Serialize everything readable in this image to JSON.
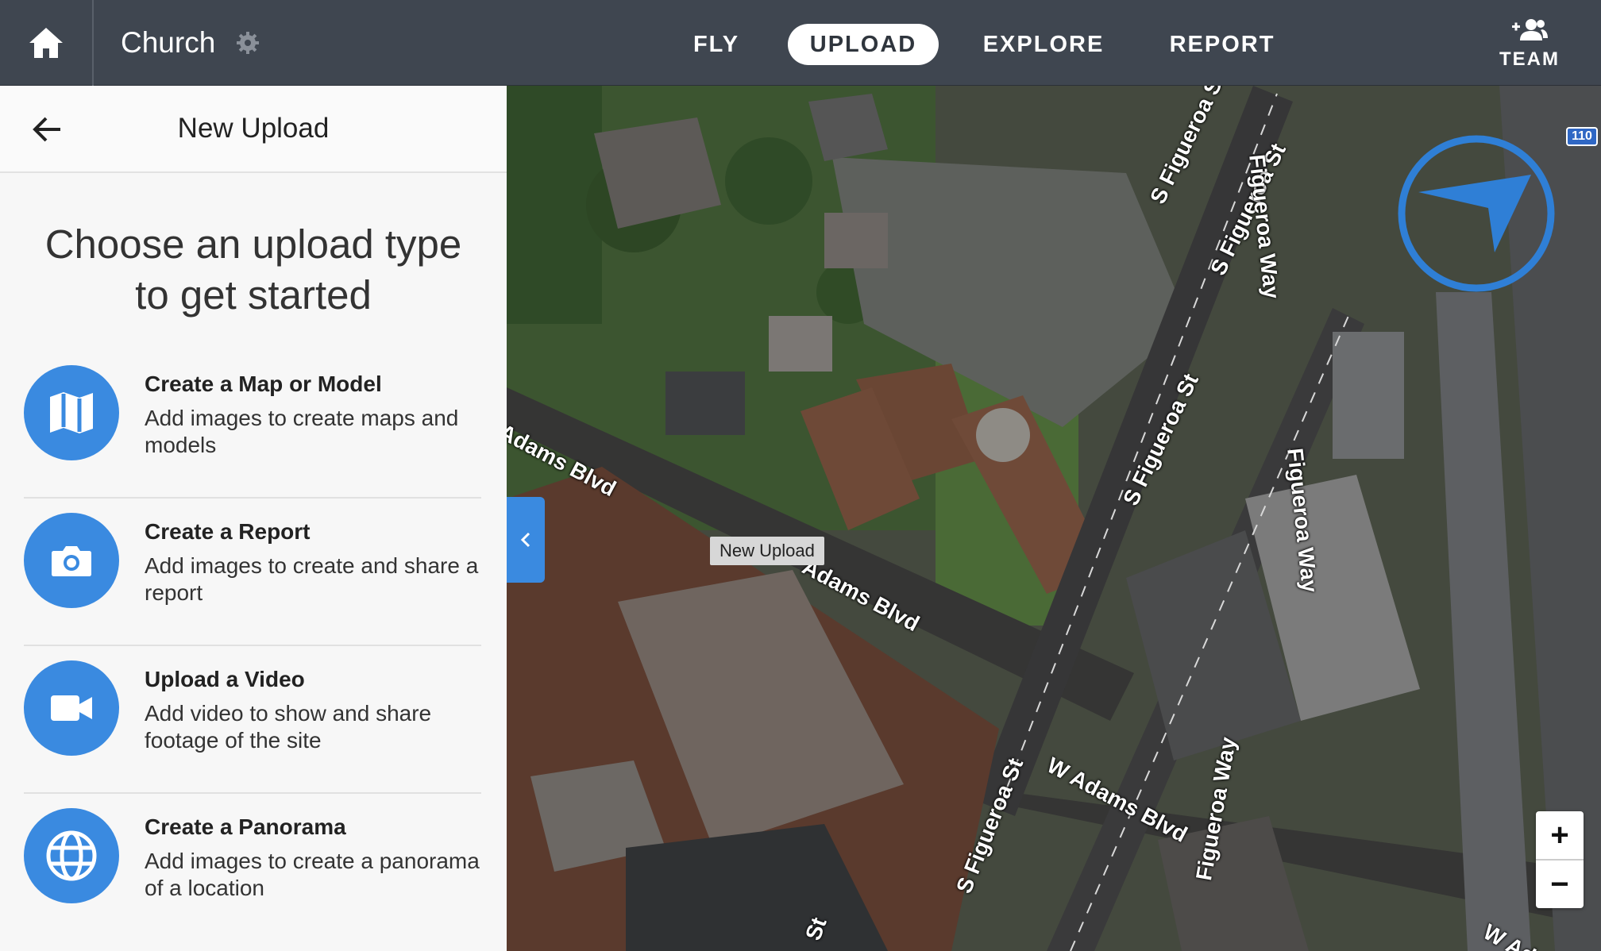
{
  "topbar": {
    "project_name": "Church",
    "nav": [
      "FLY",
      "UPLOAD",
      "EXPLORE",
      "REPORT"
    ],
    "active_nav": "UPLOAD",
    "team_label": "TEAM"
  },
  "panel": {
    "title": "New Upload",
    "lead": "Choose an upload type to get started",
    "options": [
      {
        "icon": "map-icon",
        "title": "Create a Map or Model",
        "desc": "Add images to create maps and models"
      },
      {
        "icon": "camera-icon",
        "title": "Create a Report",
        "desc": "Add images to create and share a report"
      },
      {
        "icon": "video-camera-icon",
        "title": "Upload a Video",
        "desc": "Add video to show and share footage of the site"
      },
      {
        "icon": "globe-icon",
        "title": "Create a Panorama",
        "desc": "Add images to create a panorama of a location"
      }
    ]
  },
  "map": {
    "tooltip": "New Upload",
    "streets": [
      "Adams Blvd",
      "Adams Blvd",
      "W Adams Blvd",
      "S Figueroa St",
      "S Figueroa St",
      "S Figueroa St",
      "Figueroa Way",
      "Figueroa Way",
      "Figueroa Way",
      "S Figueroa St",
      "W Ad",
      "St"
    ],
    "highway_shield": "110",
    "zoom_in": "+",
    "zoom_out": "−"
  },
  "colors": {
    "accent": "#3a8ae0",
    "topbar": "#3f4650",
    "panel": "#f7f7f7"
  }
}
